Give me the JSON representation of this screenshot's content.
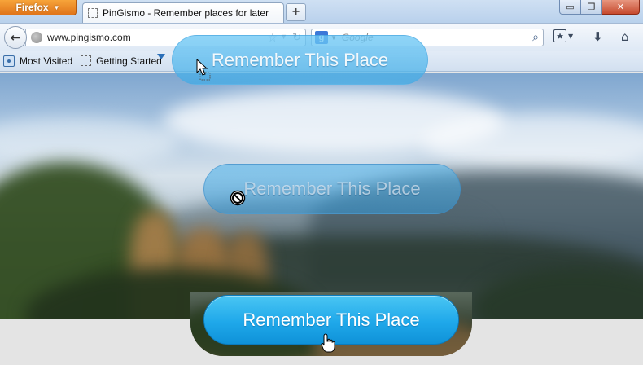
{
  "browser": {
    "app_button_label": "Firefox",
    "tab_title": "PinGismo - Remember places for later",
    "new_tab_label": "+",
    "window_controls": {
      "minimize": "▭",
      "maximize": "❐",
      "close": "✕"
    }
  },
  "navbar": {
    "back_icon": "←",
    "url": "www.pingismo.com",
    "search_engine_letter": "g",
    "search_placeholder": "Google"
  },
  "bookmarks": {
    "items": [
      {
        "label": "Most Visited",
        "icon": "most-visited-icon"
      },
      {
        "label": "Getting Started",
        "icon": "page-icon"
      }
    ]
  },
  "page": {
    "buttons": {
      "dragged_top_label": "Remember This Place",
      "disabled_mid_label": "Remember This Place",
      "main_label": "Remember This Place"
    }
  },
  "colors": {
    "button_blue": "#1fa8ea",
    "firefox_orange": "#e0741a"
  },
  "cursors": [
    "arrow-drag-cursor",
    "not-allowed-cursor",
    "hand-pointer-cursor"
  ]
}
